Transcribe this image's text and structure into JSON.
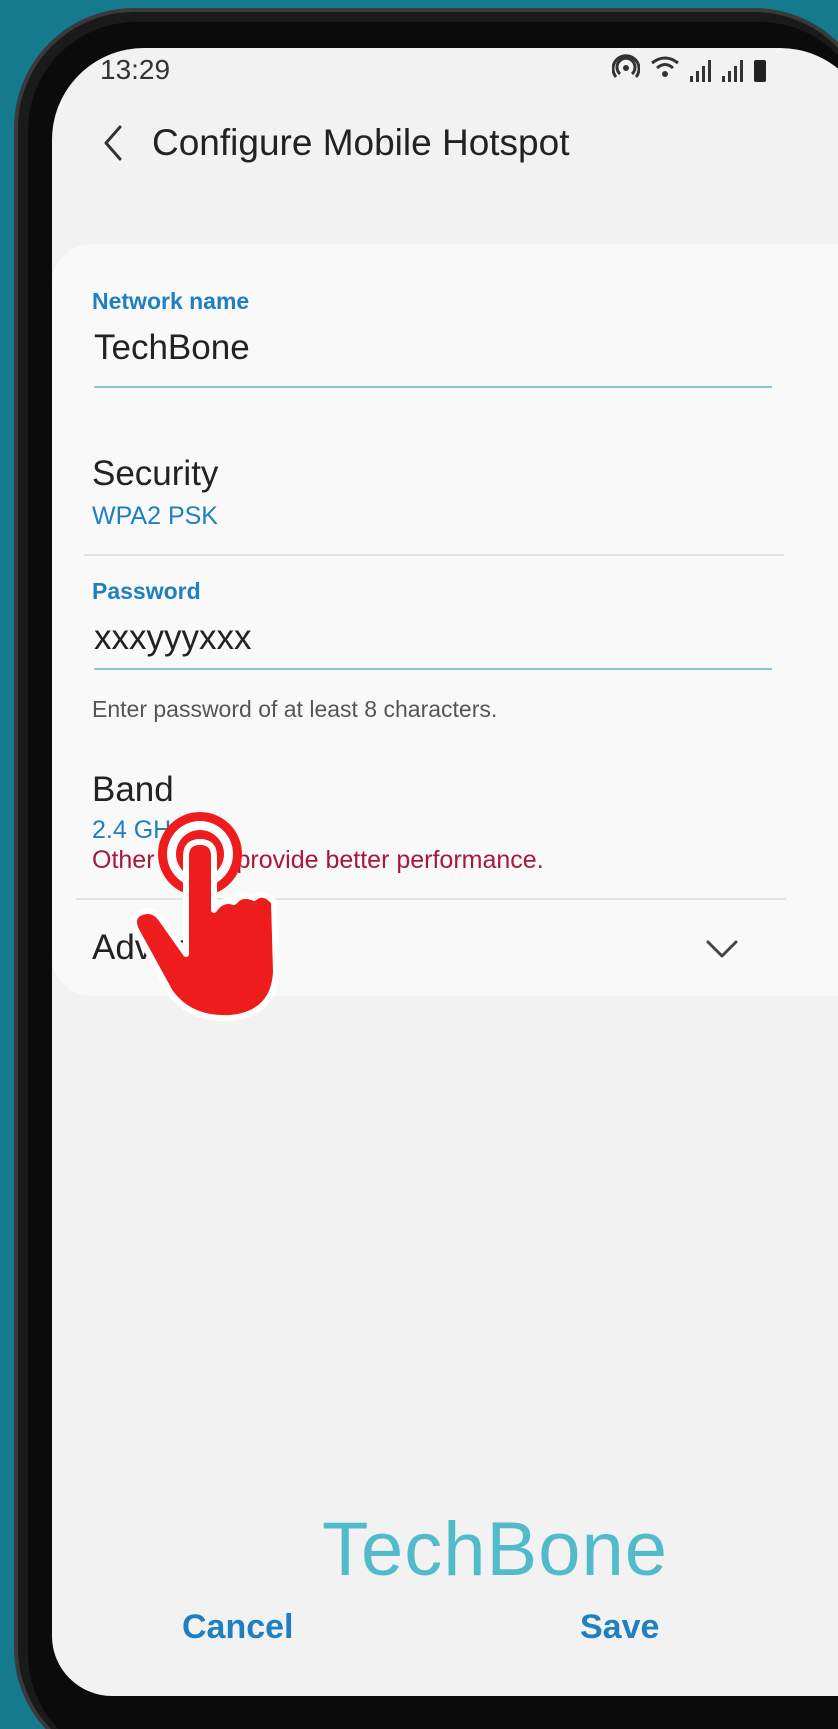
{
  "status_bar": {
    "time": "13:29"
  },
  "header": {
    "title": "Configure Mobile Hotspot"
  },
  "network_name": {
    "label": "Network name",
    "value": "TechBone"
  },
  "security": {
    "title": "Security",
    "value": "WPA2 PSK"
  },
  "password": {
    "label": "Password",
    "value": "xxxyyyxxx",
    "helper": "Enter password of at least 8 characters."
  },
  "band": {
    "title": "Band",
    "value": "2.4 GHz",
    "warning": "Other bands provide better performance."
  },
  "advanced": {
    "title": "Advanced"
  },
  "footer": {
    "cancel_label": "Cancel",
    "save_label": "Save"
  },
  "watermark": {
    "text": "TechBone"
  },
  "colors": {
    "accent": "#1f7fc1",
    "warning": "#a8183c",
    "tap_indicator": "#ee1c1c",
    "background": "#167a8e"
  },
  "icons": [
    "back-arrow-icon",
    "hotspot-icon",
    "wifi-icon",
    "signal-icon",
    "battery-icon",
    "chevron-down-icon",
    "tap-hand-icon"
  ]
}
